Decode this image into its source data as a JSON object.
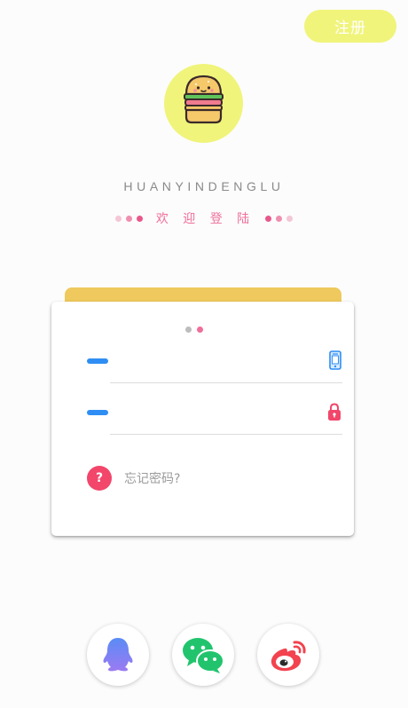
{
  "header": {
    "register_label": "注册"
  },
  "brand": {
    "logo_icon": "hamburger-icon",
    "title": "HUANYINDENGLU",
    "welcome": "欢 迎 登 陆",
    "dot_colors": [
      "#f4c6d6",
      "#ef8fb0",
      "#e9578a"
    ]
  },
  "login_card": {
    "pager_dots": [
      "#bdbdbd",
      "#ef6f9b"
    ],
    "phone_field": {
      "icon": "phone-icon",
      "value": ""
    },
    "password_field": {
      "icon": "lock-icon",
      "value": ""
    },
    "forgot_label": "忘记密码?"
  },
  "social_login": [
    {
      "name": "qq",
      "icon": "qq-icon"
    },
    {
      "name": "wechat",
      "icon": "wechat-icon"
    },
    {
      "name": "weibo",
      "icon": "weibo-icon"
    }
  ],
  "colors": {
    "accent_yellow": "#f0f47a",
    "card_back": "#efc95d",
    "pink": "#ef6f9b",
    "blue": "#2f8ef3",
    "red": "#f2466b"
  }
}
